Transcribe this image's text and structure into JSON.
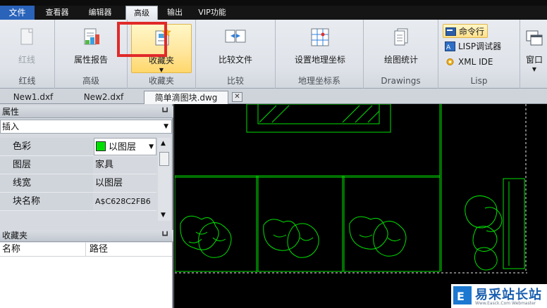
{
  "menu": {
    "file": "文件",
    "tabs": [
      "查看器",
      "编辑器",
      "高级",
      "输出",
      "VIP功能"
    ]
  },
  "ribbon": {
    "groups": {
      "redline": "红线",
      "advanced": "高级",
      "favorites": "收藏夹",
      "compare": "比较",
      "geo": "地理坐标系",
      "drawings": "Drawings",
      "lisp": "Lisp"
    },
    "buttons": {
      "redline": "红线",
      "block_attr": "属性报告",
      "favorites": "收藏夹",
      "compare_files": "比较文件",
      "set_geo": "设置地理坐标",
      "drawing_stats": "绘图统计",
      "command_line": "命令行",
      "lisp_debugger": "LISP调试器",
      "xml_ide": "XML IDE",
      "window": "窗口"
    }
  },
  "doc_tabs": [
    "New1.dxf",
    "New2.dxf",
    "简单滴图块.dwg"
  ],
  "properties": {
    "title": "属性",
    "selected": "插入",
    "rows": [
      {
        "key": "色彩",
        "value": "以图层"
      },
      {
        "key": "图层",
        "value": "家具"
      },
      {
        "key": "线宽",
        "value": "以图层"
      },
      {
        "key": "块名称",
        "value": "A$C628C2FB6"
      }
    ]
  },
  "favorites_panel": {
    "title": "收藏夹",
    "columns": [
      "名称",
      "路径"
    ]
  },
  "watermark": {
    "text": "易采站长站",
    "url": "Www.Easck.Com  Webmaster"
  },
  "colors": {
    "accent": "#2a63ba",
    "canvas": "#000000",
    "cad_lines": "#00e000",
    "highlight_box": "#e02a2a"
  }
}
